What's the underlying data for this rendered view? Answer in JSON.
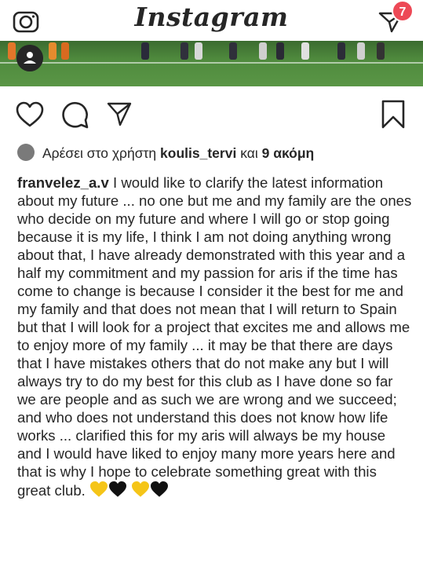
{
  "header": {
    "app_name": "Instagram",
    "badge_count": "7",
    "icons": [
      "camera-icon",
      "direct-message-icon"
    ]
  },
  "likes": {
    "prefix": "Αρέσει στο χρήστη",
    "user": "koulis_tervi",
    "conjunction": "και",
    "others": "9 ακόμη"
  },
  "caption": {
    "username": "franvelez_a.v",
    "text": "I would like to clarify the latest information about my future ... no one but me and my family are the ones who decide on my future and where I will go or stop going because it is my life, I think I am not doing anything wrong about that,  I have already demonstrated with this year and a half my commitment and my passion for aris if the time has come to change is because I consider it the best for me and my family and that does not mean that I will return to Spain but that I will look for a project that excites me and allows me to enjoy more of my family ... it may be that there are days that I have mistakes others that do not make any but I will always try to do my best for this club as I have done so far we are people and as such we are wrong  and we succeed;  and who does not understand this does not know how life works ... clarified this for my aris will always be my house and I would have liked to enjoy many more years here and that is why I hope to celebrate something great with this great club."
  },
  "colors": {
    "text": "#262626",
    "badge": "#ed4956",
    "gold_heart": "#f5c518",
    "black_heart": "#111111",
    "grass": "#4f8a3d"
  },
  "action_icons": [
    "like-icon",
    "comment-icon",
    "share-icon",
    "save-icon"
  ]
}
